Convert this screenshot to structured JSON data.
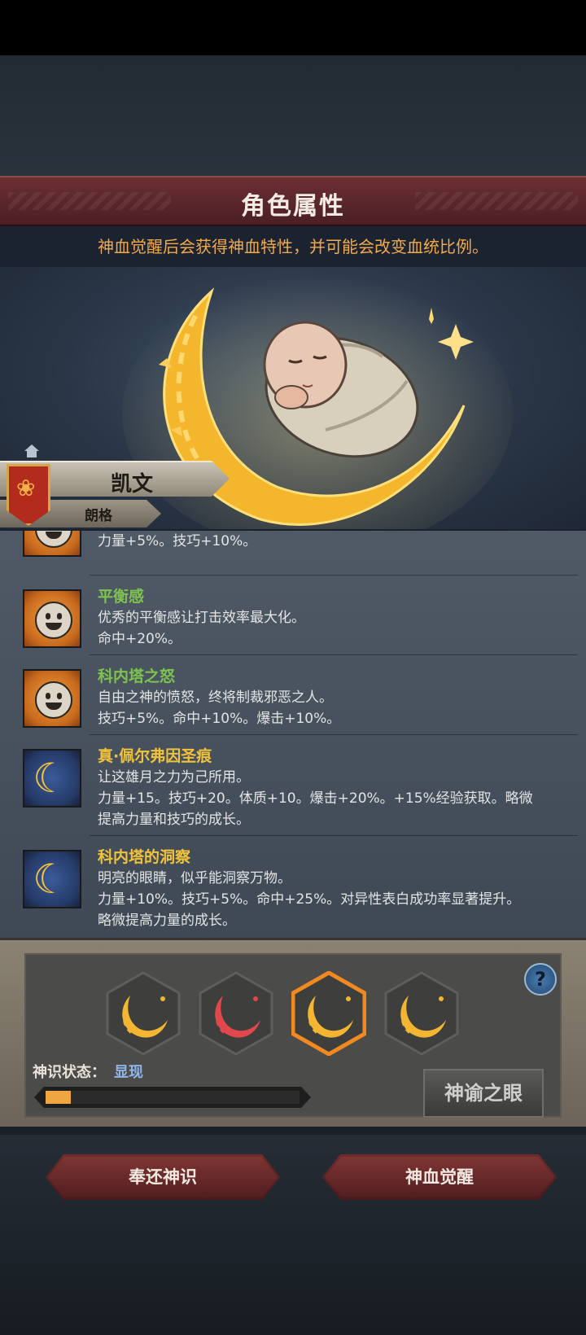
{
  "header": {
    "title": "角色属性",
    "subtitle": "神血觉醒后会获得神血特性，并可能会改变血统比例。"
  },
  "character": {
    "name": "凯文",
    "surname": "朗格"
  },
  "traits": [
    {
      "name": "",
      "name_color": "#7ec251",
      "icon": "smile-icon",
      "desc": [
        "力量+5%。技巧+10%。"
      ]
    },
    {
      "name": "平衡感",
      "name_color": "#7ec251",
      "icon": "smile-icon",
      "desc": [
        "优秀的平衡感让打击效率最大化。",
        "命中+20%。"
      ]
    },
    {
      "name": "科内塔之怒",
      "name_color": "#7ec251",
      "icon": "smile-icon",
      "desc": [
        "自由之神的愤怒，终将制裁邪恶之人。",
        "技巧+5%。命中+10%。爆击+10%。"
      ]
    },
    {
      "name": "真·佩尔弗因圣痕",
      "name_color": "#f1c33c",
      "icon": "moon-icon",
      "desc": [
        "让这雄月之力为己所用。",
        "力量+15。技巧+20。体质+10。爆击+20%。+15%经验获取。略微",
        "提高力量和技巧的成长。"
      ]
    },
    {
      "name": "科内塔的洞察",
      "name_color": "#f1c33c",
      "icon": "moon-icon",
      "desc": [
        "明亮的眼睛，似乎能洞察万物。",
        "力量+10%。技巧+5%。命中+25%。对异性表白成功率显著提升。",
        "略微提高力量的成长。"
      ]
    }
  ],
  "runes": {
    "colors": [
      "#f3b532",
      "#e0484e",
      "#f3b532",
      "#f3b532"
    ],
    "selected_index": 2
  },
  "status": {
    "label": "神识状态：",
    "value": "显现",
    "progress": 0.1
  },
  "buttons": {
    "oracle": "神谕之眼",
    "help": "?",
    "return": "奉还神识",
    "awaken": "神血觉醒"
  }
}
